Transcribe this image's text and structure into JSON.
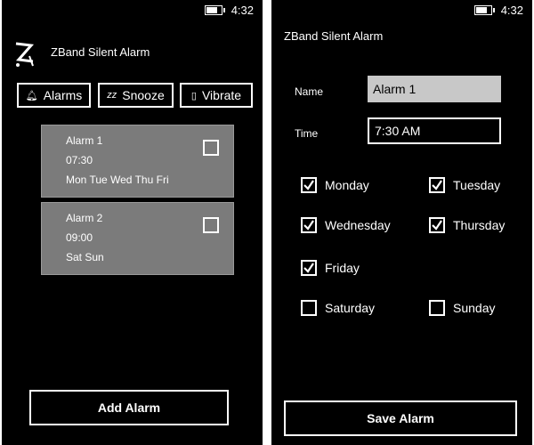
{
  "status": {
    "time": "4:32"
  },
  "app": {
    "title": "ZBand Silent Alarm"
  },
  "tabs": [
    {
      "label": "Alarms",
      "icon": "bell-icon"
    },
    {
      "label": "Snooze",
      "icon": "zz-icon"
    },
    {
      "label": "Vibrate",
      "icon": "phone-vibrate-icon"
    }
  ],
  "alarms": [
    {
      "name": "Alarm 1",
      "time": "07:30",
      "days": "Mon Tue Wed Thu Fri",
      "checked": false
    },
    {
      "name": "Alarm 2",
      "time": "09:00",
      "days": "Sat Sun",
      "checked": false
    }
  ],
  "add_button": "Add Alarm",
  "edit": {
    "name_label": "Name",
    "name_value": "Alarm 1",
    "time_label": "Time",
    "time_value": "7:30 AM",
    "days": [
      {
        "label": "Monday",
        "checked": true
      },
      {
        "label": "Tuesday",
        "checked": true
      },
      {
        "label": "Wednesday",
        "checked": true
      },
      {
        "label": "Thursday",
        "checked": true
      },
      {
        "label": "Friday",
        "checked": true
      },
      {
        "label": "Saturday",
        "checked": false
      },
      {
        "label": "Sunday",
        "checked": false
      }
    ],
    "save_button": "Save Alarm"
  }
}
